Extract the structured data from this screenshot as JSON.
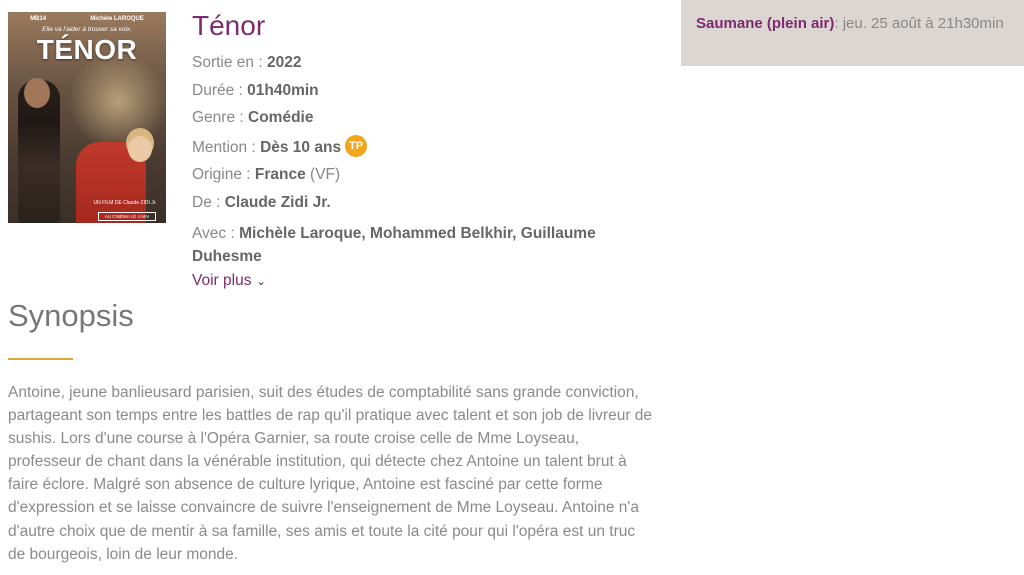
{
  "poster": {
    "actor1": "MB14",
    "actor2": "Michèle LAROQUE",
    "tagline": "Elle va l'aider à trouver sa voix.",
    "title": "TÉNOR",
    "credit": "UN FILM DE Claude ZIDI Jr.",
    "release": "AU CINÉMA LE 4 MAI"
  },
  "film": {
    "title": "Ténor",
    "sortie_label": "Sortie en : ",
    "sortie": "2022",
    "duree_label": "Durée : ",
    "duree": "01h40min",
    "genre_label": "Genre : ",
    "genre": "Comédie",
    "mention_label": "Mention : ",
    "mention": "Dès 10 ans",
    "mention_badge": "TP",
    "origine_label": "Origine : ",
    "origine": "France",
    "origine_suffix": " (VF)",
    "de_label": "De : ",
    "de": "Claude Zidi Jr.",
    "avec_label": "Avec : ",
    "avec": "Michèle Laroque, Mohammed Belkhir, Guillaume Duhesme",
    "voir_plus": "Voir plus"
  },
  "synopsis": {
    "heading": "Synopsis",
    "text": "Antoine, jeune banlieusard parisien, suit des études de comptabilité sans grande conviction, partageant son temps entre les battles de rap qu'il pratique avec talent et son job de livreur de sushis. Lors d'une course à l'Opéra Garnier, sa route croise celle de Mme Loyseau, professeur de chant dans la vénérable institution, qui détecte chez Antoine un talent brut à faire éclore. Malgré son absence de culture lyrique, Antoine est fasciné par cette forme d'expression et se laisse convaincre de suivre l'enseignement de Mme Loyseau. Antoine n'a d'autre choix que de mentir à sa famille, ses amis et toute la cité pour qui l'opéra est un truc de bourgeois, loin de leur monde."
  },
  "showtime": {
    "venue": "Saumane (plein air)",
    "date": ": jeu. 25 août à 21h30min"
  },
  "colors": {
    "accent": "#7c2b6e",
    "underline": "#e0a63a",
    "badge": "#f2a51f",
    "showtime_bg": "#dcd6d2"
  }
}
